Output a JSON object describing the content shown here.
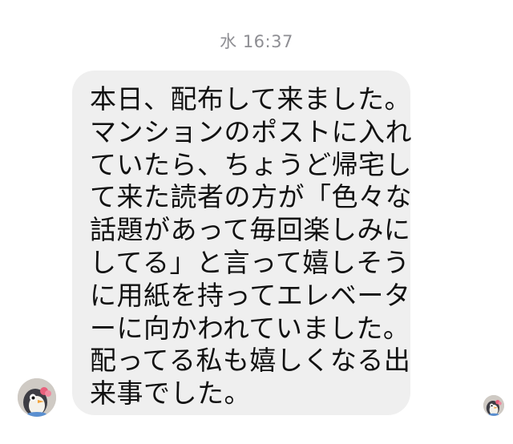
{
  "thread": {
    "timestamp": "水 16:37"
  },
  "message": {
    "lines": [
      "本日、配布して来ました。",
      "マンションのポストに入れ",
      "ていたら、ちょうど帰宅し",
      "て来た読者の方が「色々な",
      "話題があって毎回楽しみに",
      "してる」と言って嬉しそう",
      "に用紙を持ってエレベータ",
      "ーに向かわれていました。",
      "配ってる私も嬉しくなる出",
      "来事でした。"
    ]
  },
  "icons": {
    "sender_avatar": "penguin-avatar-icon",
    "read_receipt": "read-receipt-avatar-icon"
  },
  "colors": {
    "bubble_bg": "#efefef",
    "timestamp": "#8e8e93",
    "text": "#111111",
    "background": "#ffffff"
  }
}
